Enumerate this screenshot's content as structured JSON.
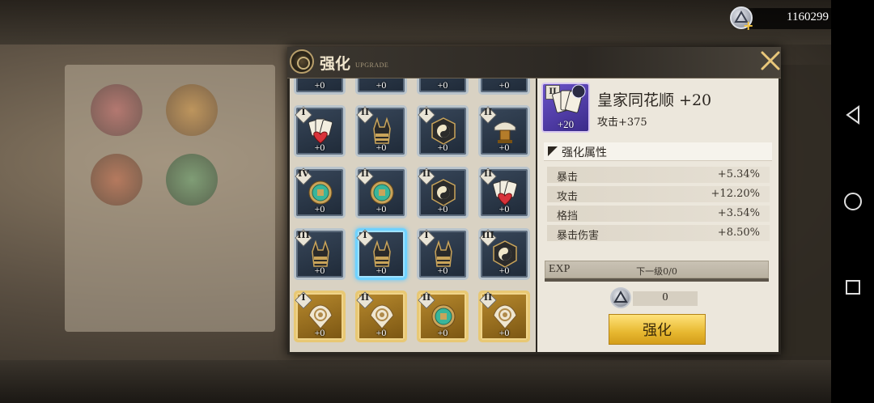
{
  "currency": {
    "amount": "1160299",
    "icon": "upgrade-stone-icon",
    "add_icon": "plus-icon"
  },
  "dialog": {
    "title": "强化",
    "subtitle": "UPGRADE",
    "close_icon": "close-icon"
  },
  "grid": {
    "partial_row": [
      {
        "level": "+0"
      },
      {
        "level": "+0"
      },
      {
        "level": "+0"
      },
      {
        "level": "+0"
      }
    ],
    "rows": [
      [
        {
          "tier": "I",
          "level": "+0",
          "icon": "playing-cards-icon",
          "rarity": "blue"
        },
        {
          "tier": "II",
          "level": "+0",
          "icon": "anubis-head-icon",
          "rarity": "blue"
        },
        {
          "tier": "I",
          "level": "+0",
          "icon": "yin-yang-icon",
          "rarity": "blue"
        },
        {
          "tier": "II",
          "level": "+0",
          "icon": "card-lamp-icon",
          "rarity": "blue"
        }
      ],
      [
        {
          "tier": "IV",
          "level": "+0",
          "icon": "jade-coin-icon",
          "rarity": "blue"
        },
        {
          "tier": "II",
          "level": "+0",
          "icon": "jade-coin-icon",
          "rarity": "blue"
        },
        {
          "tier": "II",
          "level": "+0",
          "icon": "yin-yang-icon",
          "rarity": "blue"
        },
        {
          "tier": "II",
          "level": "+0",
          "icon": "playing-cards-icon",
          "rarity": "blue"
        }
      ],
      [
        {
          "tier": "III",
          "level": "+0",
          "icon": "anubis-head-icon",
          "rarity": "blue"
        },
        {
          "tier": "I",
          "level": "+0",
          "icon": "anubis-head-icon",
          "rarity": "blue",
          "selected": true
        },
        {
          "tier": "I",
          "level": "+0",
          "icon": "anubis-head-icon",
          "rarity": "blue"
        },
        {
          "tier": "III",
          "level": "+0",
          "icon": "yin-yang-icon",
          "rarity": "blue"
        }
      ],
      [
        {
          "tier": "I",
          "level": "+0",
          "icon": "seashell-icon",
          "rarity": "gold"
        },
        {
          "tier": "II",
          "level": "+0",
          "icon": "seashell-icon",
          "rarity": "gold"
        },
        {
          "tier": "II",
          "level": "+0",
          "icon": "jade-coin-icon",
          "rarity": "gold"
        },
        {
          "tier": "II",
          "level": "+0",
          "icon": "seashell-icon",
          "rarity": "gold"
        }
      ]
    ]
  },
  "detail": {
    "thumb_tier": "II",
    "thumb_level": "+20",
    "name": "皇家同花顺 +20",
    "main_stat": "攻击+375",
    "section_title": "强化属性",
    "attributes": [
      {
        "label": "暴击",
        "value": "+5.34%"
      },
      {
        "label": "攻击",
        "value": "+12.20%"
      },
      {
        "label": "格挡",
        "value": "+3.54%"
      },
      {
        "label": "暴击伤害",
        "value": "+8.50%"
      }
    ],
    "exp_label": "EXP",
    "exp_text": "下一级0/0",
    "exp_progress": 0,
    "cost": "0",
    "upgrade_button": "强化"
  },
  "colors": {
    "accent_gold": "#e7b830",
    "selected_blue": "#6fd2ff",
    "panel_bg": "#ece7dc"
  }
}
